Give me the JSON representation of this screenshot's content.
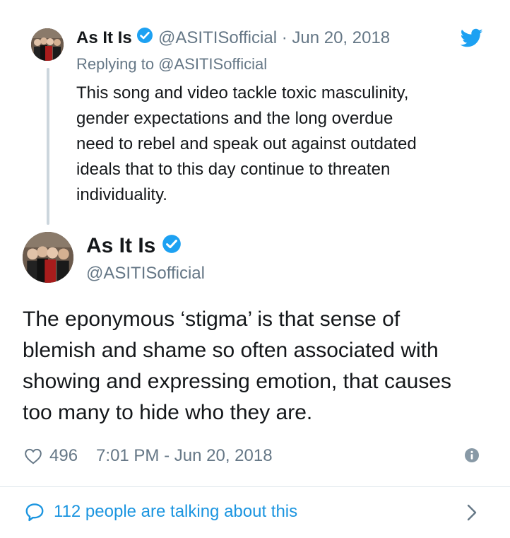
{
  "reply_tweet": {
    "author_name": "As It Is",
    "handle_date": "@ASITISofficial · Jun 20, 2018",
    "replying_to": "Replying to @ASITISofficial",
    "text_lines": [
      "This song and video tackle toxic masculinity,",
      "gender expectations and the long overdue",
      "need to rebel and speak out against outdated",
      "ideals that to this day continue to threaten",
      "individuality."
    ]
  },
  "main_tweet": {
    "author_name": "As It Is",
    "handle": "@ASITISofficial",
    "text_lines": [
      "The eponymous ‘stigma’ is that sense of",
      "blemish and shame so often associated with",
      "showing and expressing emotion, that causes",
      "too many to hide who they are."
    ],
    "likes": "496",
    "timestamp": "7:01 PM - Jun 20, 2018"
  },
  "footer": {
    "talking_text": "112 people are talking about this"
  },
  "icons": {
    "brand": "twitter-bird-icon",
    "verified": "verified-badge-icon",
    "like": "heart-icon",
    "info": "info-icon",
    "reply": "speech-bubble-icon",
    "chevron": "chevron-right-icon"
  },
  "colors": {
    "twitter_blue": "#1da1f2",
    "link_blue": "#1b95e0",
    "text": "#14171a",
    "muted": "#657786"
  }
}
